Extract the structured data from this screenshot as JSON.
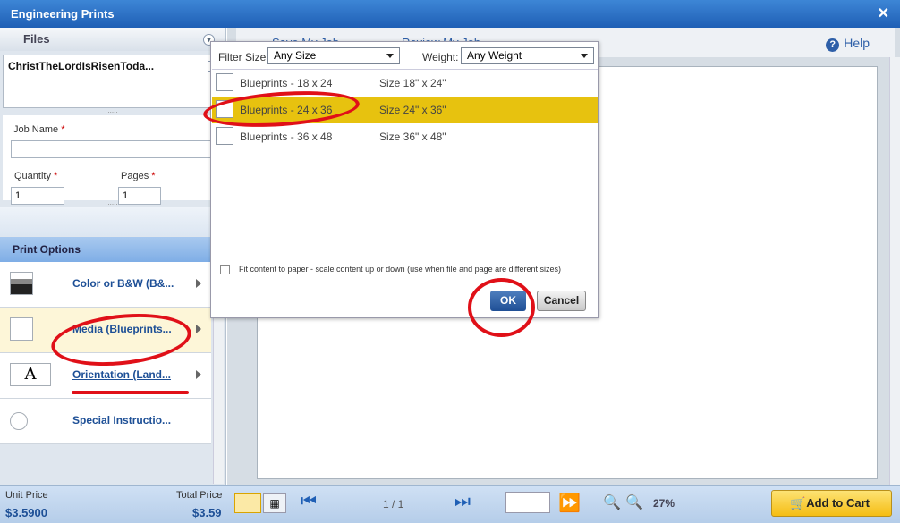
{
  "window": {
    "title": "Engineering Prints",
    "close": "✕"
  },
  "sidebar": {
    "files_header": "Files",
    "file_name": "ChristTheLordIsRisenToda...",
    "job_name_label": "Job Name",
    "job_name_value": "",
    "quantity_label": "Quantity",
    "quantity_value": "1",
    "pages_label": "Pages",
    "pages_value": "1",
    "required_mark": "*",
    "print_options_header": "Print Options",
    "options": [
      {
        "label": "Color or B&W (B&...",
        "icon": "color-swatch-icon"
      },
      {
        "label": "Media (Blueprints...",
        "icon": "media-blank-icon"
      },
      {
        "label": "Orientation (Land...",
        "icon": "orientation-a-icon",
        "glyph": "A"
      },
      {
        "label": "Special Instructio...",
        "icon": "radio-circle-icon"
      }
    ]
  },
  "toolbar": {
    "save": "Save My Job",
    "review": "Review My Job",
    "help": "Help",
    "help_glyph": "?"
  },
  "modal": {
    "filter_size_label": "Filter Size:",
    "filter_size_value": "Any Size",
    "weight_label": "Weight:",
    "weight_value": "Any Weight",
    "rows": [
      {
        "name": "Blueprints - 18 x 24",
        "size": "Size 18\" x 24\""
      },
      {
        "name": "Blueprints - 24 x 36",
        "size": "Size 24\" x 36\"",
        "highlighted": true
      },
      {
        "name": "Blueprints - 36 x 48",
        "size": "Size 36\" x 48\""
      }
    ],
    "fit_label": "Fit content to paper - scale content up or down (use when file and page are different sizes)",
    "ok": "OK",
    "cancel": "Cancel"
  },
  "bottom": {
    "unit_price_label": "Unit Price",
    "unit_price": "$3.5900",
    "total_price_label": "Total Price",
    "total_price": "$3.59",
    "page_indicator": "1 / 1",
    "page_input": "",
    "zoom": "27%",
    "add_to_cart": "Add to Cart"
  },
  "colors": {
    "accent": "#1f5fb5",
    "highlight": "#e7c20f",
    "annotation": "#e01018"
  }
}
